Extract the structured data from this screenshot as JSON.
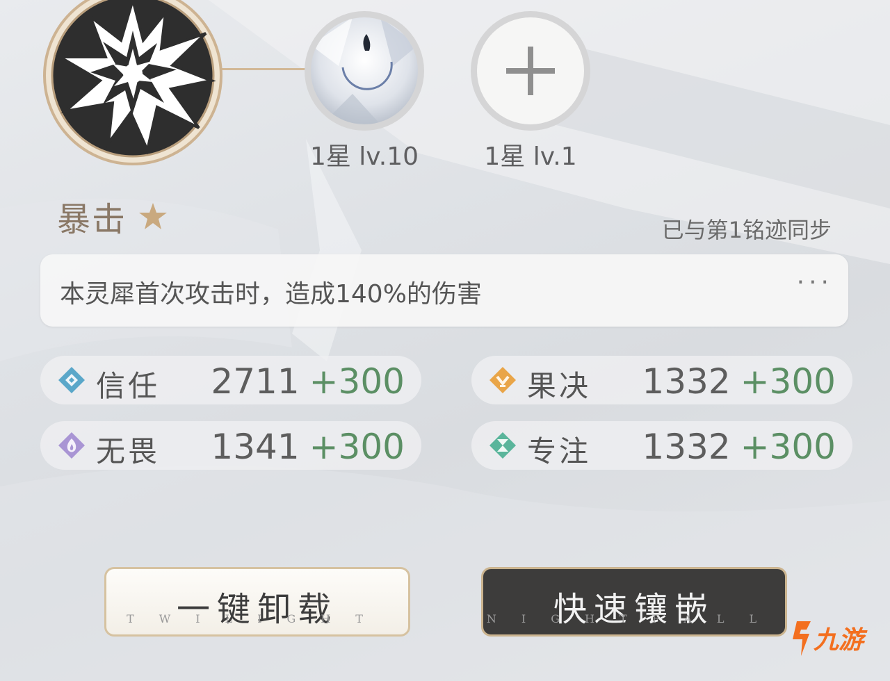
{
  "skill": {
    "name": "暴击",
    "icon": "burst-explosion-icon",
    "sync_status": "已与第1铭迹同步"
  },
  "slots": [
    {
      "label": "1星 lv.10",
      "icon": "crescent-moon-icon"
    },
    {
      "label": "1星 lv.1",
      "icon": "plus-icon"
    }
  ],
  "description": {
    "text": "本灵犀首次攻击时，造成140%的伤害",
    "more": "···"
  },
  "stats": [
    {
      "name": "信任",
      "base": "2711",
      "bonus": "+300",
      "icon": "trust-diamond-icon",
      "color": "#5aa7c9"
    },
    {
      "name": "果决",
      "base": "1332",
      "bonus": "+300",
      "icon": "resolve-diamond-icon",
      "color": "#e9a548"
    },
    {
      "name": "无畏",
      "base": "1341",
      "bonus": "+300",
      "icon": "fearless-diamond-icon",
      "color": "#a995d4"
    },
    {
      "name": "专注",
      "base": "1332",
      "bonus": "+300",
      "icon": "focus-diamond-icon",
      "color": "#5ab59b"
    }
  ],
  "buttons": {
    "unequip": {
      "label": "一键卸载",
      "sub": "TWILIGHT"
    },
    "quick": {
      "label": "快速镶嵌",
      "sub": "NIGHTFALL"
    }
  },
  "watermark": {
    "text": "九游"
  },
  "colors": {
    "accent_gold": "#d2b896",
    "bonus_green": "#5b8f64",
    "dark_button": "#3d3c3b"
  }
}
